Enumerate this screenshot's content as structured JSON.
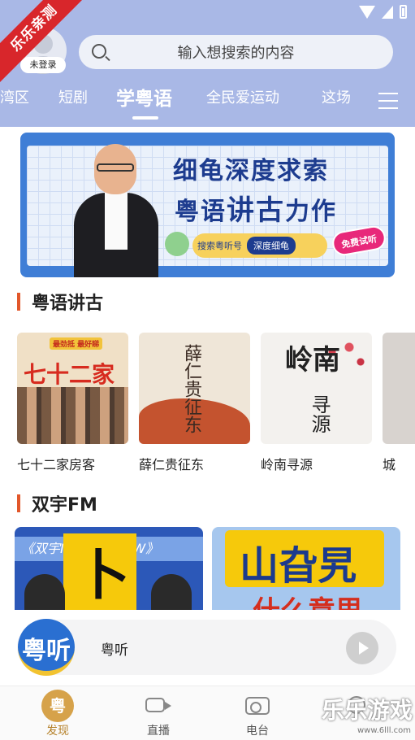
{
  "header": {
    "ribbon_text": "乐乐亲测",
    "login_badge": "未登录",
    "search_placeholder": "输入想搜索的内容",
    "tabs": [
      "湾区",
      "短剧",
      "学粤语",
      "全民爱运动",
      "这场"
    ],
    "active_tab": "学粤语"
  },
  "banner": {
    "title_line1": "细龟深度求索",
    "title_line2a": "粤语",
    "title_line2b": "讲古",
    "title_line2c": "力作",
    "pill_text": "搜索粤听号",
    "pill_button": "深度细龟",
    "badge": "免费试听"
  },
  "section1": {
    "title": "粤语讲古",
    "items": [
      {
        "label": "七十二家房客",
        "cover_text": "七十二家",
        "cover_tag": "最劲抵 最好睇"
      },
      {
        "label": "薛仁贵征东",
        "cover_text": "薛仁贵征东"
      },
      {
        "label": "岭南寻源",
        "cover_text": "岭南",
        "cover_text2": "寻源"
      },
      {
        "label": "城"
      }
    ]
  },
  "section2": {
    "title": "双宇FM",
    "cards": [
      {
        "strip": "《双宇MORN  SHOW》",
        "big": "卜"
      },
      {
        "big": "山旮旯",
        "sub": "什么意思"
      }
    ]
  },
  "player": {
    "logo_text": "粤听",
    "title": "粤听"
  },
  "bottom_nav": {
    "items": [
      {
        "label": "发现",
        "icon_text": "粤"
      },
      {
        "label": "直播"
      },
      {
        "label": "电台"
      },
      {
        "label": ""
      }
    ]
  },
  "watermark": {
    "text": "乐乐游戏",
    "sub": "www.6lll.com"
  },
  "colors": {
    "header_bg": "#a9b8e6",
    "accent": "#e2572a",
    "nav_active": "#b5812a"
  }
}
